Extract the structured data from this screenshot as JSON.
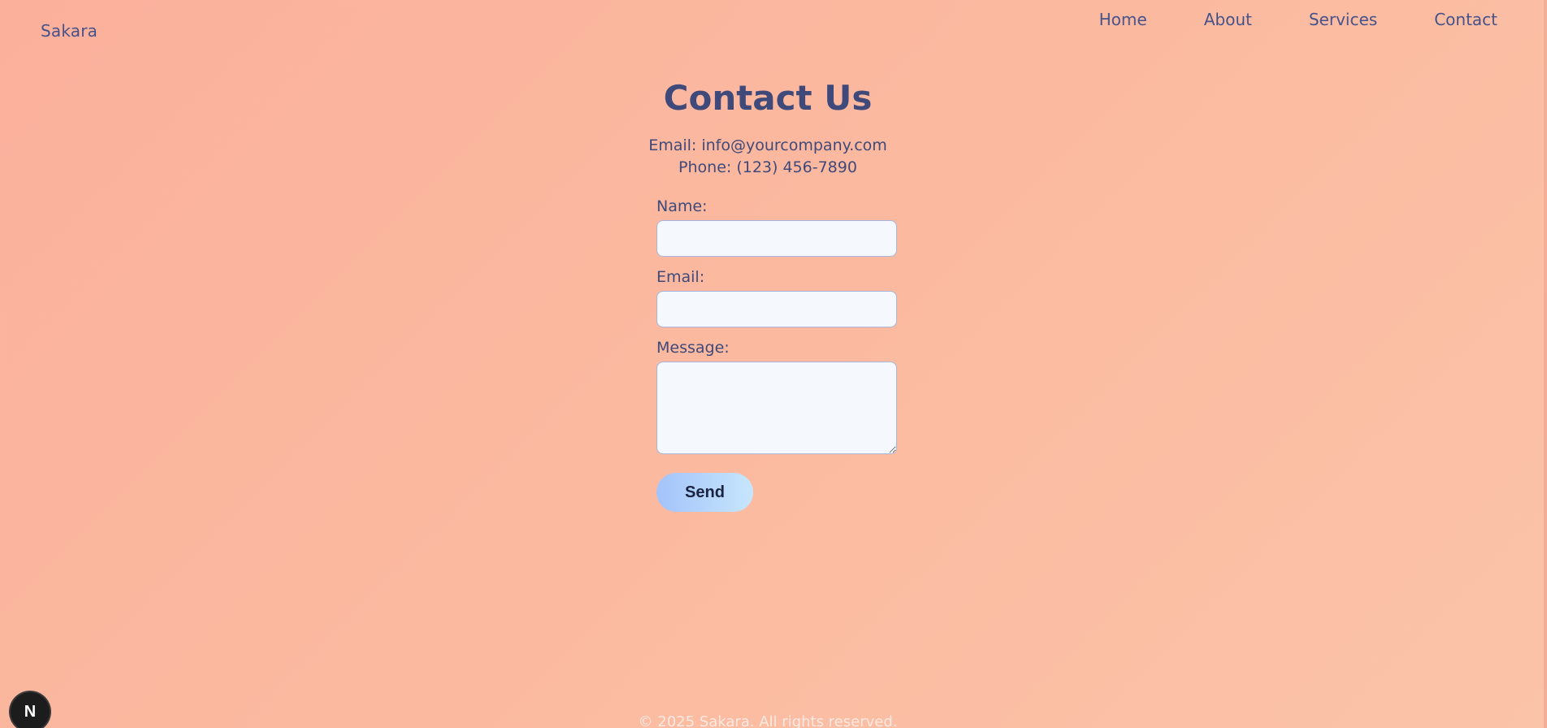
{
  "brand": {
    "name": "Sakara"
  },
  "nav": {
    "items": [
      {
        "label": "Home"
      },
      {
        "label": "About"
      },
      {
        "label": "Services"
      },
      {
        "label": "Contact"
      }
    ]
  },
  "main": {
    "title": "Contact Us",
    "email_line": "Email: info@yourcompany.com",
    "phone_line": "Phone: (123) 456-7890"
  },
  "form": {
    "name_label": "Name:",
    "name_value": "",
    "email_label": "Email:",
    "email_value": "",
    "message_label": "Message:",
    "message_value": "",
    "send_label": "Send"
  },
  "footer": {
    "copyright": "© 2025 Sakara. All rights reserved."
  },
  "dev_badge": {
    "letter": "N"
  },
  "colors": {
    "background_start": "#fbb09c",
    "background_end": "#fbc3a8",
    "text": "#3f4a7a",
    "button_gradient_start": "#a3c3fb",
    "button_gradient_end": "#c7e6fc",
    "input_background": "#f5f8fc"
  }
}
